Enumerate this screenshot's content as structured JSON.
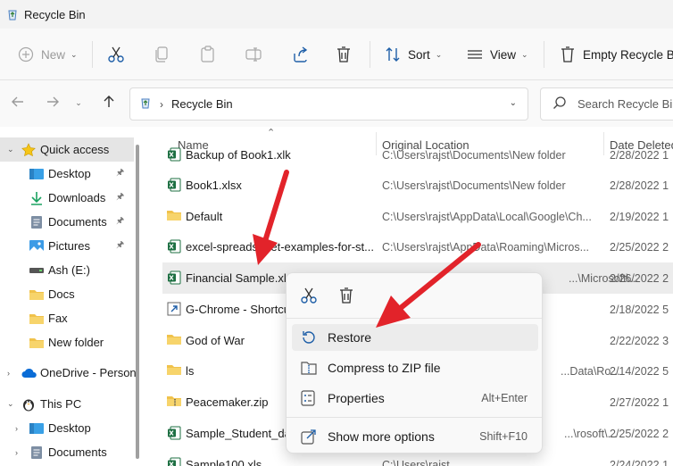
{
  "window": {
    "title": "Recycle Bin"
  },
  "toolbar": {
    "new_label": "New",
    "sort_label": "Sort",
    "view_label": "View",
    "empty_label": "Empty Recycle Bin"
  },
  "address": {
    "path": "Recycle Bin"
  },
  "search": {
    "placeholder": "Search Recycle Bin"
  },
  "sidebar": {
    "items": [
      {
        "label": "Quick access",
        "icon": "star-icon",
        "pinned": false
      },
      {
        "label": "Desktop",
        "icon": "desktop-icon",
        "pinned": true
      },
      {
        "label": "Downloads",
        "icon": "download-icon",
        "pinned": true
      },
      {
        "label": "Documents",
        "icon": "documents-icon",
        "pinned": true
      },
      {
        "label": "Pictures",
        "icon": "pictures-icon",
        "pinned": true
      },
      {
        "label": "Ash (E:)",
        "icon": "drive-icon",
        "pinned": false
      },
      {
        "label": "Docs",
        "icon": "folder-icon",
        "pinned": false
      },
      {
        "label": "Fax",
        "icon": "folder-icon",
        "pinned": false
      },
      {
        "label": "New folder",
        "icon": "folder-icon",
        "pinned": false
      },
      {
        "label": "OneDrive - Person",
        "icon": "cloud-icon",
        "pinned": false
      },
      {
        "label": "This PC",
        "icon": "pc-icon",
        "pinned": false
      },
      {
        "label": "Desktop",
        "icon": "desktop-icon",
        "pinned": false
      },
      {
        "label": "Documents",
        "icon": "documents-icon",
        "pinned": false
      }
    ]
  },
  "columns": {
    "name": "Name",
    "location": "Original Location",
    "date": "Date Deleted"
  },
  "files": [
    {
      "name": "Backup of Book1.xlk",
      "location": "C:\\Users\\rajst\\Documents\\New folder",
      "date": "2/28/2022 1",
      "icon": "excel-icon"
    },
    {
      "name": "Book1.xlsx",
      "location": "C:\\Users\\rajst\\Documents\\New folder",
      "date": "2/28/2022 1",
      "icon": "excel-icon"
    },
    {
      "name": "Default",
      "location": "C:\\Users\\rajst\\AppData\\Local\\Google\\Ch...",
      "date": "2/19/2022 1",
      "icon": "folder-icon"
    },
    {
      "name": "excel-spreadsheet-examples-for-st...",
      "location": "C:\\Users\\rajst\\AppData\\Roaming\\Micros...",
      "date": "2/25/2022 2",
      "icon": "excel-icon"
    },
    {
      "name": "Financial Sample.xlsx",
      "location": "...\\Microsoft\\...",
      "date": "2/26/2022 2",
      "icon": "excel-icon"
    },
    {
      "name": "G-Chrome - Shortcut",
      "location": "",
      "date": "2/18/2022 5",
      "icon": "shortcut-icon"
    },
    {
      "name": "God of War",
      "location": "",
      "date": "2/22/2022 3",
      "icon": "folder-icon"
    },
    {
      "name": "ls",
      "location": "...Data\\Ro...",
      "date": "2/14/2022 5",
      "icon": "folder-icon"
    },
    {
      "name": "Peacemaker.zip",
      "location": "",
      "date": "2/27/2022 1",
      "icon": "zip-icon"
    },
    {
      "name": "Sample_Student_data",
      "location": "...\\rosoft\\...",
      "date": "2/25/2022 2",
      "icon": "excel-icon"
    },
    {
      "name": "Sample100.xls",
      "location": "C:\\Users\\rajst...",
      "date": "2/24/2022 1",
      "icon": "excel-icon"
    }
  ],
  "context_menu": {
    "items": [
      {
        "label": "Restore",
        "shortcut": ""
      },
      {
        "label": "Compress to ZIP file",
        "shortcut": ""
      },
      {
        "label": "Properties",
        "shortcut": "Alt+Enter"
      },
      {
        "label": "Show more options",
        "shortcut": "Shift+F10"
      }
    ]
  },
  "colors": {
    "accent": "#0067c0",
    "arrow": "#e2232a",
    "excel_green": "#1d6f42",
    "folder_yellow": "#f0c24b",
    "selection": "#e5e5e5"
  }
}
